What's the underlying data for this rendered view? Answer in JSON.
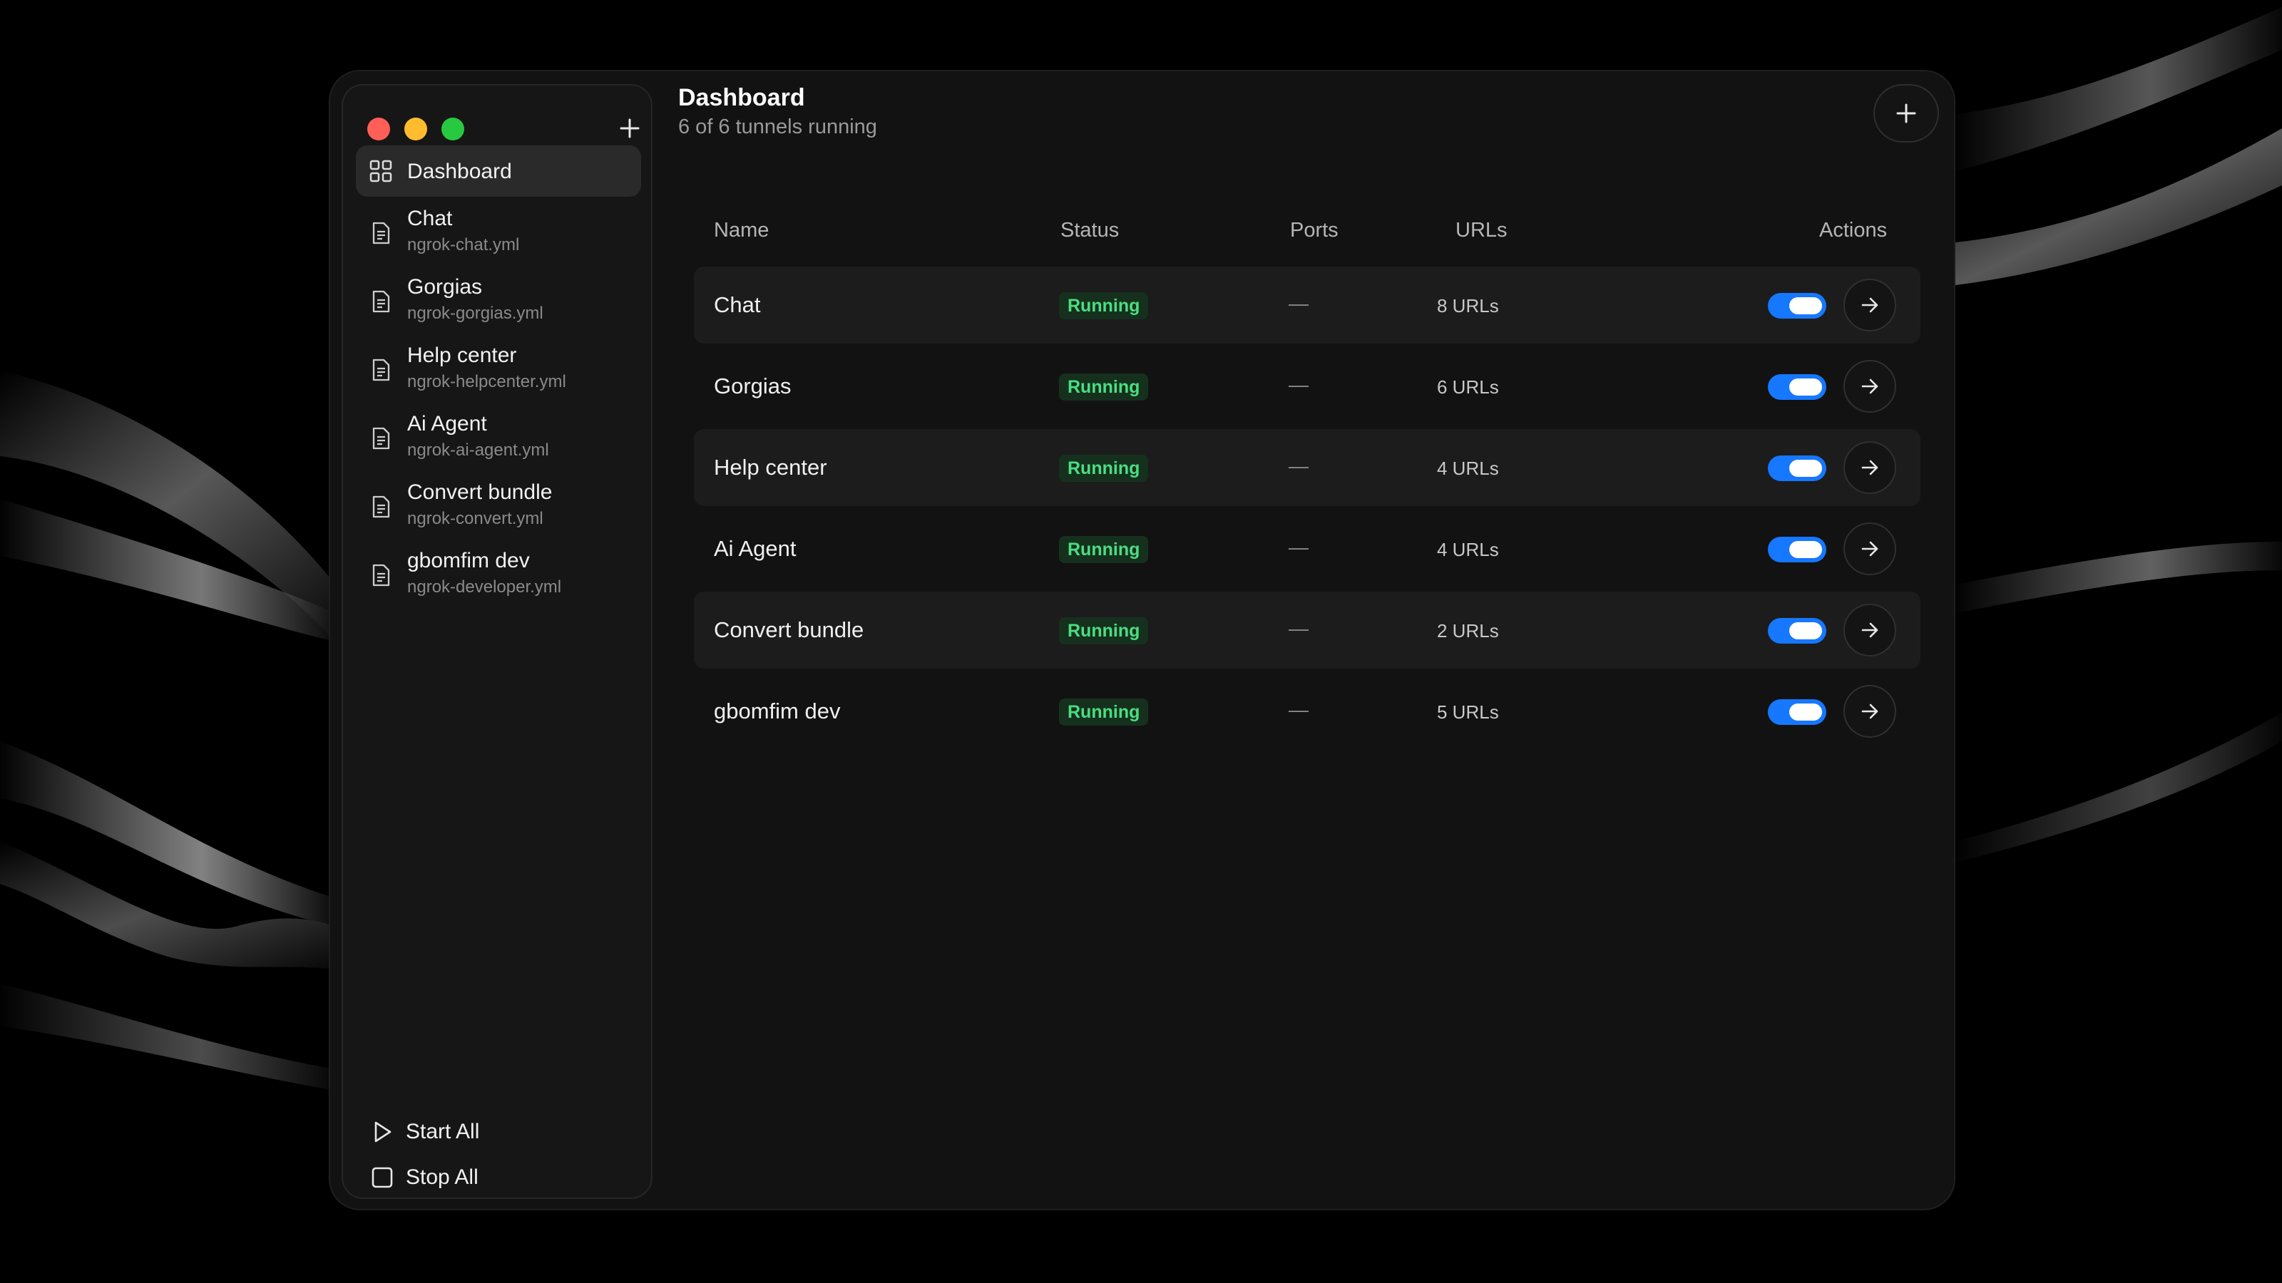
{
  "sidebar": {
    "window_controls": [
      "close",
      "minimize",
      "maximize"
    ],
    "add_icon": "plus-icon",
    "active": {
      "label": "Dashboard",
      "icon": "grid-icon"
    },
    "items": [
      {
        "title": "Chat",
        "file": "ngrok-chat.yml",
        "icon": "file-text-icon"
      },
      {
        "title": "Gorgias",
        "file": "ngrok-gorgias.yml",
        "icon": "file-text-icon"
      },
      {
        "title": "Help center",
        "file": "ngrok-helpcenter.yml",
        "icon": "file-text-icon"
      },
      {
        "title": "Ai Agent",
        "file": "ngrok-ai-agent.yml",
        "icon": "file-text-icon"
      },
      {
        "title": "Convert bundle",
        "file": "ngrok-convert.yml",
        "icon": "file-text-icon"
      },
      {
        "title": "gbomfim dev",
        "file": "ngrok-developer.yml",
        "icon": "file-text-icon"
      }
    ],
    "start_all": "Start All",
    "stop_all": "Stop All"
  },
  "header": {
    "title": "Dashboard",
    "subtitle": "6 of 6 tunnels running",
    "add_icon": "plus-icon"
  },
  "table": {
    "columns": [
      "Name",
      "Status",
      "Ports",
      "URLs",
      "Actions"
    ],
    "rows": [
      {
        "name": "Chat",
        "status": "Running",
        "ports": "—",
        "urls": "8 URLs",
        "enabled": true
      },
      {
        "name": "Gorgias",
        "status": "Running",
        "ports": "—",
        "urls": "6 URLs",
        "enabled": true
      },
      {
        "name": "Help center",
        "status": "Running",
        "ports": "—",
        "urls": "4 URLs",
        "enabled": true
      },
      {
        "name": "Ai Agent",
        "status": "Running",
        "ports": "—",
        "urls": "4 URLs",
        "enabled": true
      },
      {
        "name": "Convert bundle",
        "status": "Running",
        "ports": "—",
        "urls": "2 URLs",
        "enabled": true
      },
      {
        "name": "gbomfim dev",
        "status": "Running",
        "ports": "—",
        "urls": "5 URLs",
        "enabled": true
      }
    ]
  },
  "colors": {
    "accent": "#1677ff",
    "running_text": "#4ade80",
    "running_bg": "#16301e",
    "close": "#ff5f57",
    "minimize": "#febc2e",
    "maximize": "#28c840"
  }
}
